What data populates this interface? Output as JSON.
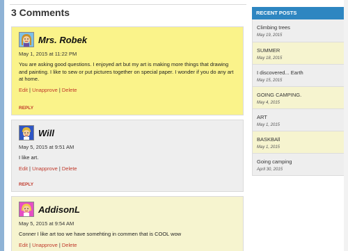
{
  "comments_section": {
    "title": "3 Comments",
    "comments": [
      {
        "author": "Mrs. Robek",
        "avatar": "woman-avatar-icon",
        "date": "May 1, 2015 at 11:22 PM",
        "text": "You are asking good questions. I enjoyed art but my art is making more things that drawing and painting. I like to sew or put pictures together on special paper. I wonder if you do any art at home.",
        "actions": {
          "edit": "Edit",
          "unapprove": "Unapprove",
          "delete": "Delete"
        },
        "reply": "REPLY"
      },
      {
        "author": "Will",
        "avatar": "boy-avatar-icon",
        "date": "May 5, 2015 at 9:51 AM",
        "text": "I like art.",
        "actions": {
          "edit": "Edit",
          "unapprove": "Unapprove",
          "delete": "Delete"
        },
        "reply": "REPLY"
      },
      {
        "author": "AddisonL",
        "avatar": "girl-avatar-icon",
        "date": "May 5, 2015 at 9:54 AM",
        "text": "Conner I like art too we have somehting in commen that is COOL wow",
        "actions": {
          "edit": "Edit",
          "unapprove": "Unapprove",
          "delete": "Delete"
        }
      }
    ]
  },
  "sidebar": {
    "header": "RECENT POSTS",
    "posts": [
      {
        "title": "Climbing trees",
        "date": "May 19, 2015"
      },
      {
        "title": "SUMMER",
        "date": "May 18, 2015"
      },
      {
        "title": "I discovered... Earth",
        "date": "May 15, 2015"
      },
      {
        "title": "GOING CAMPING.",
        "date": "May 4, 2015"
      },
      {
        "title": "ART",
        "date": "May 1, 2015"
      },
      {
        "title": "BASKBAll",
        "date": "May 1, 2015"
      },
      {
        "title": "Going camping",
        "date": "April 30, 2015"
      }
    ]
  },
  "colors": {
    "accent": "#2e86c1",
    "link": "#c0392b",
    "highlight": "#faf38a"
  }
}
